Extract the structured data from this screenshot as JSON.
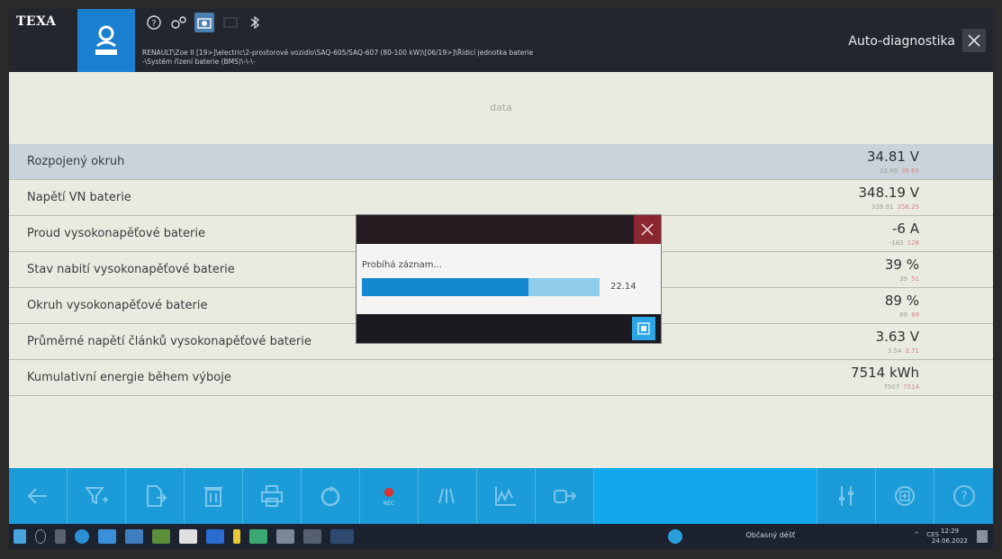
{
  "header": {
    "logo": "TEXA",
    "breadcrumb_line1": "RENAULT\\Zoe II [19>]\\electric\\2-prostorové vozidlo\\SAQ-605/SAQ-607 (80-100 kW)\\[06/19>]\\Řídicí jednotka baterie",
    "breadcrumb_line2": "-\\Systém řízení baterie (BMS)\\-\\-\\-",
    "app_title": "Auto-diagnostika",
    "icons": [
      "profile-icon",
      "help-icon",
      "settings-icon",
      "camera-icon",
      "battery-icon",
      "bluetooth-icon",
      "close-icon"
    ]
  },
  "section_label": "data",
  "rows": [
    {
      "label": "Rozpojený okruh",
      "value": "34.81 V",
      "min": "33.99",
      "max": "35.63",
      "selected": true
    },
    {
      "label": "Napětí VN baterie",
      "value": "348.19 V",
      "min": "339.91",
      "max": "356.25",
      "selected": false
    },
    {
      "label": "Proud vysokonapěťové baterie",
      "value": "-6 A",
      "min": "-183",
      "max": "128",
      "selected": false
    },
    {
      "label": "Stav nabití vysokonapěťové baterie",
      "value": "39 %",
      "min": "39",
      "max": "51",
      "selected": false
    },
    {
      "label": "Okruh vysokonapěťové baterie",
      "value": "89 %",
      "min": "89",
      "max": "89",
      "selected": false
    },
    {
      "label": "Průměrné napětí článků vysokonapěťové baterie",
      "value": "3.63 V",
      "min": "3.54",
      "max": "3.71",
      "selected": false
    },
    {
      "label": "Kumulativní energie během výboje",
      "value": "7514 kWh",
      "min": "7507",
      "max": "7514",
      "selected": false
    }
  ],
  "dialog": {
    "message": "Probíhá záznam...",
    "progress_fraction": 0.7,
    "progress_value": "22.14"
  },
  "toolbar": {
    "rec_label": "REC",
    "buttons": [
      "back-arrow-icon",
      "filter-add-icon",
      "export-icon",
      "delete-icon",
      "print-icon",
      "refresh-icon",
      "record-icon",
      "columns-icon",
      "graph-icon",
      "connect-icon",
      "spacer",
      "adjust-icon",
      "add-icon",
      "help-icon"
    ]
  },
  "taskbar": {
    "weather": "Občasný déšť",
    "lang": "CES",
    "time": "12:29",
    "date": "24.06.2022"
  },
  "colors": {
    "accent": "#1b9bd8",
    "header_bg": "#23262c",
    "close_red": "#8a2630",
    "range_max": "#d98686",
    "progress": "#1488d0"
  }
}
